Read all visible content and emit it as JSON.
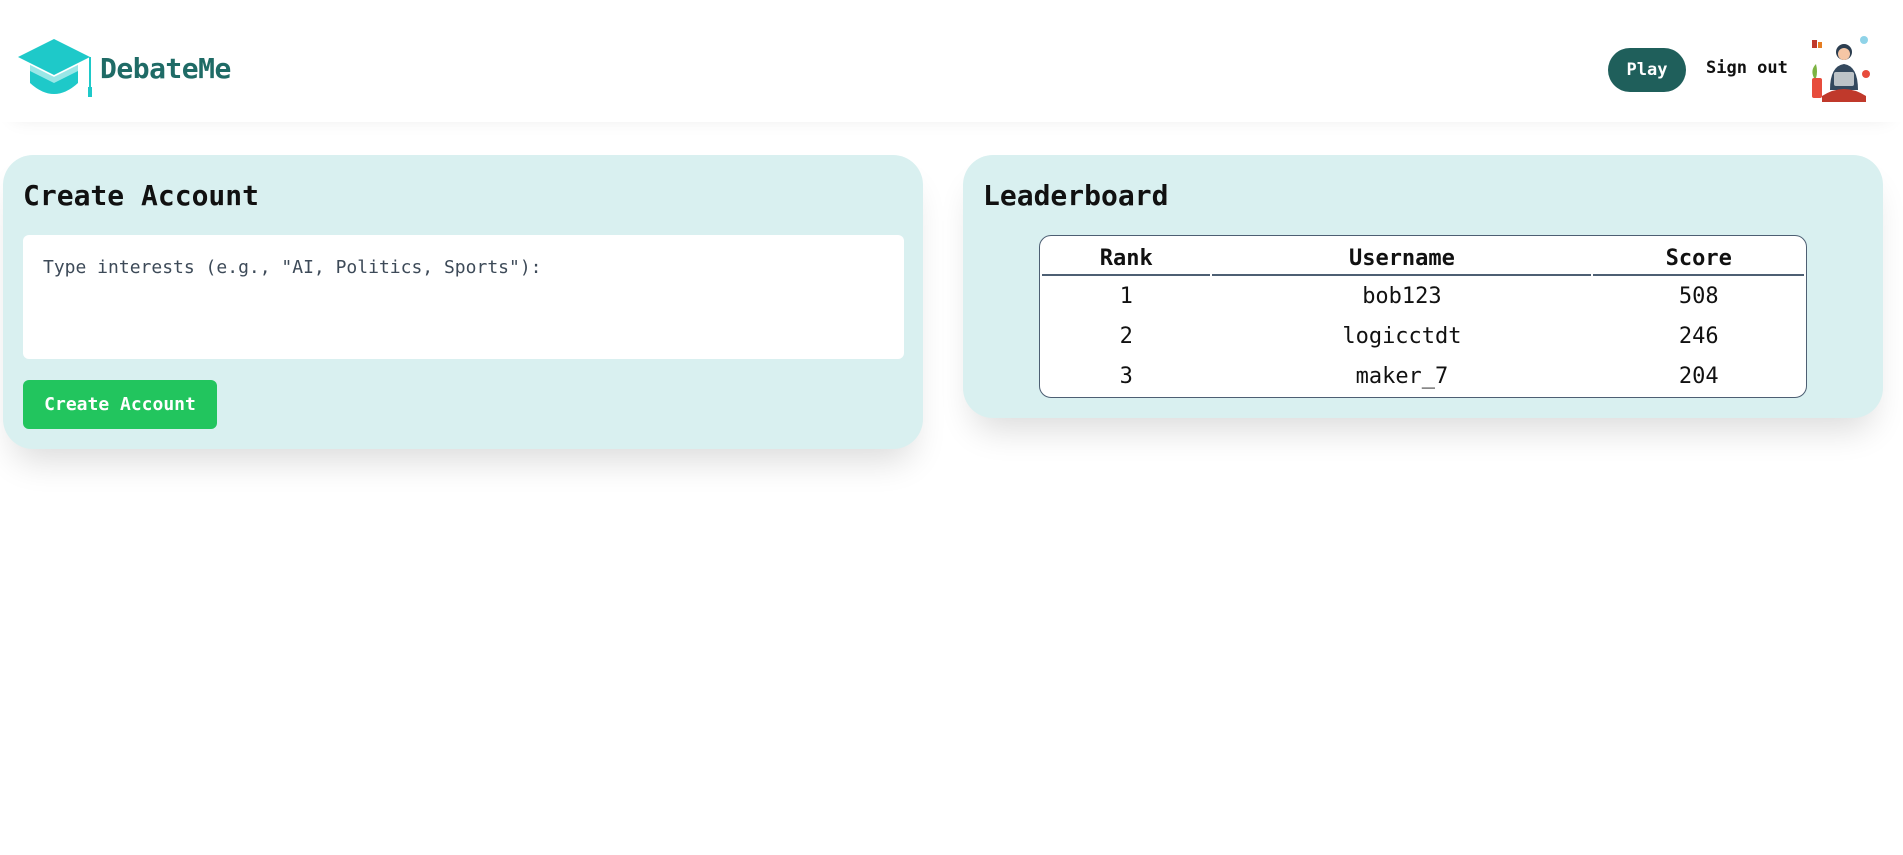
{
  "header": {
    "brand_name": "DebateMe",
    "logo_icon": "graduation-cap-icon",
    "play_label": "Play",
    "signout_label": "Sign out",
    "avatar_icon": "user-avatar-illustration"
  },
  "create_account": {
    "title": "Create Account",
    "interests_placeholder": "Type interests (e.g., \"AI, Politics, Sports\"):",
    "interests_value": "",
    "button_label": "Create Account"
  },
  "leaderboard": {
    "title": "Leaderboard",
    "columns": [
      "Rank",
      "Username",
      "Score"
    ],
    "rows": [
      [
        "1",
        "bob123",
        "508"
      ],
      [
        "2",
        "logicctdt",
        "246"
      ],
      [
        "3",
        "maker_7",
        "204"
      ]
    ]
  },
  "colors": {
    "brand_teal": "#1f6b66",
    "play_button": "#1f5f5b",
    "card_background": "#d9f0f0",
    "create_button": "#22c55e",
    "logo_cap": "#1ec9c9"
  }
}
